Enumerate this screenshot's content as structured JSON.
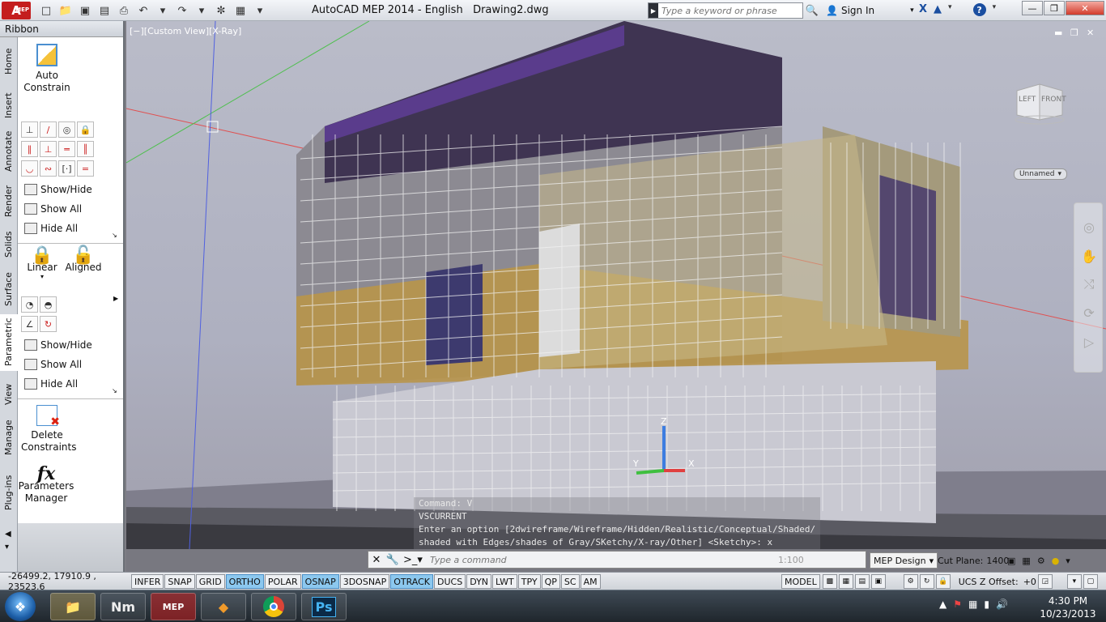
{
  "titlebar": {
    "app_letter": "A",
    "app_sub": "MEP",
    "title": "AutoCAD MEP 2014 - English   Drawing2.dwg",
    "search_placeholder": "Type a keyword or phrase",
    "sign_in": "Sign In",
    "qat_icons": [
      "new-icon",
      "open-icon",
      "save-icon",
      "print-icon",
      "undo-icon",
      "redo-icon",
      "workspace-icon",
      "properties-icon"
    ]
  },
  "ribbon": {
    "header": "Ribbon",
    "tabs": [
      "Home",
      "Insert",
      "Annotate",
      "Render",
      "Solids",
      "Surface",
      "Parametric",
      "View",
      "Manage",
      "Plug-ins"
    ],
    "active_tab": "Parametric",
    "auto_constrain": "Auto\nConstrain",
    "geo": {
      "show_hide": "Show/Hide",
      "show_all": "Show All",
      "hide_all": "Hide All"
    },
    "linear": "Linear",
    "aligned": "Aligned",
    "dim": {
      "show_hide": "Show/Hide",
      "show_all": "Show All",
      "hide_all": "Hide All"
    },
    "delete_constraints": "Delete\nConstraints",
    "params_manager": "Parameters\nManager",
    "fx": "fx"
  },
  "viewport": {
    "label": "[−][Custom View][X-Ray]",
    "cube_left": "LEFT",
    "cube_front": "FRONT",
    "named_view": "Unnamed",
    "cmd_history": [
      "Command: V",
      "VSCURRENT",
      "Enter an option [2dwireframe/Wireframe/Hidden/Realistic/Conceptual/Shaded/",
      "shaded with Edges/shades of Gray/SKetchy/X-ray/Other] <Sketchy>: x"
    ],
    "ucs_x": "X",
    "ucs_y": "Y",
    "ucs_z": "Z"
  },
  "command": {
    "placeholder": "Type a command",
    "annot_scale": "1:100"
  },
  "workspace": {
    "name": "MEP Design",
    "cut_plane_label": "Cut Plane:",
    "cut_plane_value": "1400"
  },
  "status": {
    "coords": "-26499.2, 17910.9 , 23523.6",
    "toggles": [
      {
        "label": "INFER",
        "on": false
      },
      {
        "label": "SNAP",
        "on": false
      },
      {
        "label": "GRID",
        "on": false
      },
      {
        "label": "ORTHO",
        "on": true
      },
      {
        "label": "POLAR",
        "on": false
      },
      {
        "label": "OSNAP",
        "on": true
      },
      {
        "label": "3DOSNAP",
        "on": false
      },
      {
        "label": "OTRACK",
        "on": true
      },
      {
        "label": "DUCS",
        "on": false
      },
      {
        "label": "DYN",
        "on": false
      },
      {
        "label": "LWT",
        "on": false
      },
      {
        "label": "TPY",
        "on": false
      },
      {
        "label": "QP",
        "on": false
      },
      {
        "label": "SC",
        "on": false
      },
      {
        "label": "AM",
        "on": false
      }
    ],
    "model": "MODEL",
    "ucs_offset": "UCS Z Offset:",
    "ucs_offset_value": "+0"
  },
  "taskbar": {
    "apps": [
      "explorer",
      "navisworks",
      "autocad-mep",
      "sublime",
      "chrome",
      "photoshop"
    ],
    "app_labels": [
      "",
      "Nm",
      "MEP",
      "",
      "",
      "Ps"
    ],
    "time": "4:30 PM",
    "date": "10/23/2013"
  },
  "colors": {
    "accent": "#8cc8ef",
    "autocad_red": "#c41e1e",
    "facade_gold": "#c8a450",
    "glass_purple": "#5a3c8c"
  }
}
